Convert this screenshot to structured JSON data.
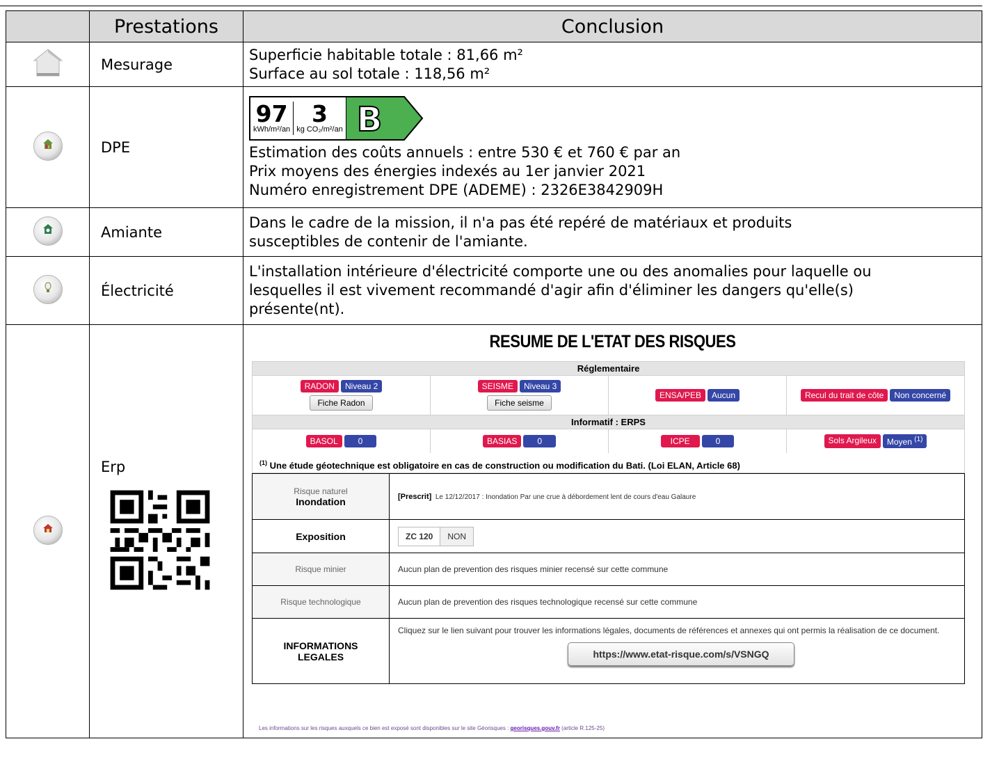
{
  "header": {
    "col_prestations": "Prestations",
    "col_conclusion": "Conclusion"
  },
  "rows": {
    "mesurage": {
      "label": "Mesurage",
      "line1": "Superficie habitable totale : 81,66 m²",
      "line2": "Surface au sol totale : 118,56 m²",
      "icon": "house-icon"
    },
    "dpe": {
      "label": "DPE",
      "energy_value": "97",
      "energy_unit": "kWh/m²/an",
      "ges_value": "3",
      "ges_unit": "kg CO₂/m²/an",
      "class_letter": "B",
      "class_color": "#4caf50",
      "line1": "Estimation des coûts annuels : entre 530 € et 760 € par an",
      "line2": "Prix moyens des énergies indexés au  1er janvier 2021",
      "line3": "Numéro enregistrement DPE (ADEME) : 2326E3842909H",
      "icon": "energy-badge-icon"
    },
    "amiante": {
      "label": "Amiante",
      "line1": "Dans le cadre de la mission, il n'a pas été repéré de matériaux et produits",
      "line2": "susceptibles de contenir de l'amiante.",
      "icon": "asbestos-badge-icon"
    },
    "electricite": {
      "label": "Électricité",
      "line1": "L'installation intérieure d'électricité comporte une ou des anomalies pour laquelle ou",
      "line2": "lesquelles il est vivement recommandé d'agir afin d'éliminer les dangers qu'elle(s)",
      "line3": "présente(nt).",
      "icon": "electricity-badge-icon"
    },
    "erp": {
      "label": "Erp",
      "icon": "natural-risks-badge-icon"
    }
  },
  "erp_panel": {
    "title": "RESUME DE L'ETAT DES RISQUES",
    "reglementaire_title": "Réglementaire",
    "radon": {
      "tag": "RADON",
      "level": "Niveau 2",
      "button": "Fiche Radon"
    },
    "seisme": {
      "tag": "SEISME",
      "level": "Niveau 3",
      "button": "Fiche seisme"
    },
    "ensa": {
      "tag": "ENSA/PEB",
      "level": "Aucun"
    },
    "recul": {
      "tag": "Recul du trait de côte",
      "level": "Non concerné"
    },
    "informatif_title": "Informatif : ERPS",
    "basol": {
      "tag": "BASOL",
      "value": "0"
    },
    "basias": {
      "tag": "BASIAS",
      "value": "0"
    },
    "icpe": {
      "tag": "ICPE",
      "value": "0"
    },
    "sols": {
      "tag": "Sols Argileux",
      "value": "Moyen",
      "sup": "(1)"
    },
    "note_sup": "(1)",
    "note": "Une étude géotechnique est obligatoire en cas de construction ou modification du Bati. (Loi ELAN, Article 68)",
    "risque_naturel_label": "Risque naturel",
    "inondation_label": "Inondation",
    "inondation_status": "[Prescrit]",
    "inondation_text": "Le 12/12/2017 : Inondation Par une crue à débordement lent de cours d'eau  Galaure",
    "exposition_label": "Exposition",
    "zone": "ZC 120",
    "zone_value": "NON",
    "minier_label": "Risque minier",
    "minier_text": "Aucun plan de prevention des risques minier recensé sur cette commune",
    "techno_label": "Risque technologique",
    "techno_text": "Aucun plan de prevention des risques technologique recensé sur cette commune",
    "legal_label_1": "INFORMATIONS",
    "legal_label_2": "LEGALES",
    "legal_text": "Cliquez sur le lien suivant pour trouver les informations légales, documents de références et annexes qui ont permis la réalisation de ce document.",
    "link": "https://www.etat-risque.com/s/VSNGQ",
    "footer_pre": "Les informations sur les risques auxquels ce bien est exposé sont disponibles sur le site Géorisques : ",
    "footer_link": "georisques.gouv.fr",
    "footer_post": " (article R.125-25)"
  }
}
